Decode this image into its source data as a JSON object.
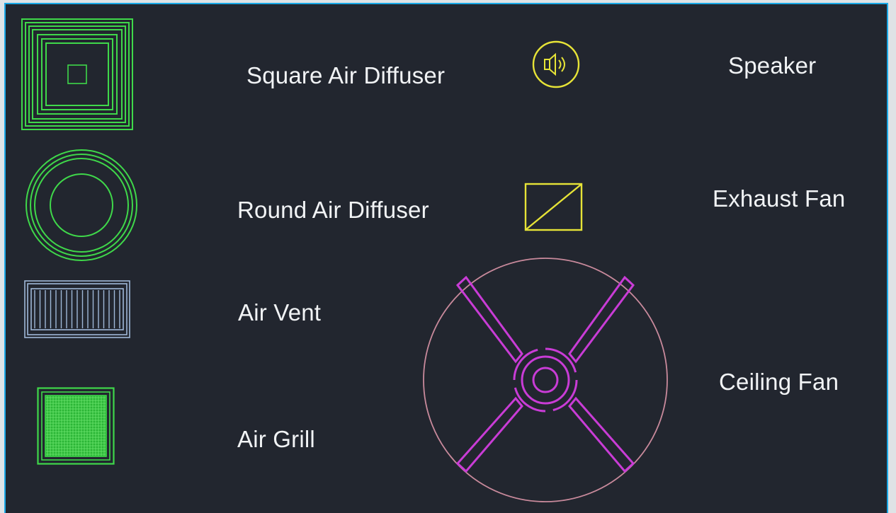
{
  "labels": {
    "square_air_diffuser": "Square Air Diffuser",
    "round_air_diffuser": "Round Air Diffuser",
    "air_vent": "Air Vent",
    "air_grill": "Air Grill",
    "speaker": "Speaker",
    "exhaust_fan": "Exhaust Fan",
    "ceiling_fan": "Ceiling Fan"
  },
  "colors": {
    "background": "#22262f",
    "frame_border": "#1aa8e6",
    "text": "#f1f3f5",
    "diffuser_green": "#3fd84a",
    "vent_blue": "#9fb8d8",
    "speaker_yellow": "#e6e337",
    "fan_magenta": "#c93cd6",
    "fan_ring": "#c98a9c"
  },
  "icons": {
    "square_air_diffuser": "square-diffuser-icon",
    "round_air_diffuser": "round-diffuser-icon",
    "air_vent": "air-vent-icon",
    "air_grill": "air-grill-icon",
    "speaker": "speaker-icon",
    "exhaust_fan": "exhaust-fan-icon",
    "ceiling_fan": "ceiling-fan-icon"
  }
}
